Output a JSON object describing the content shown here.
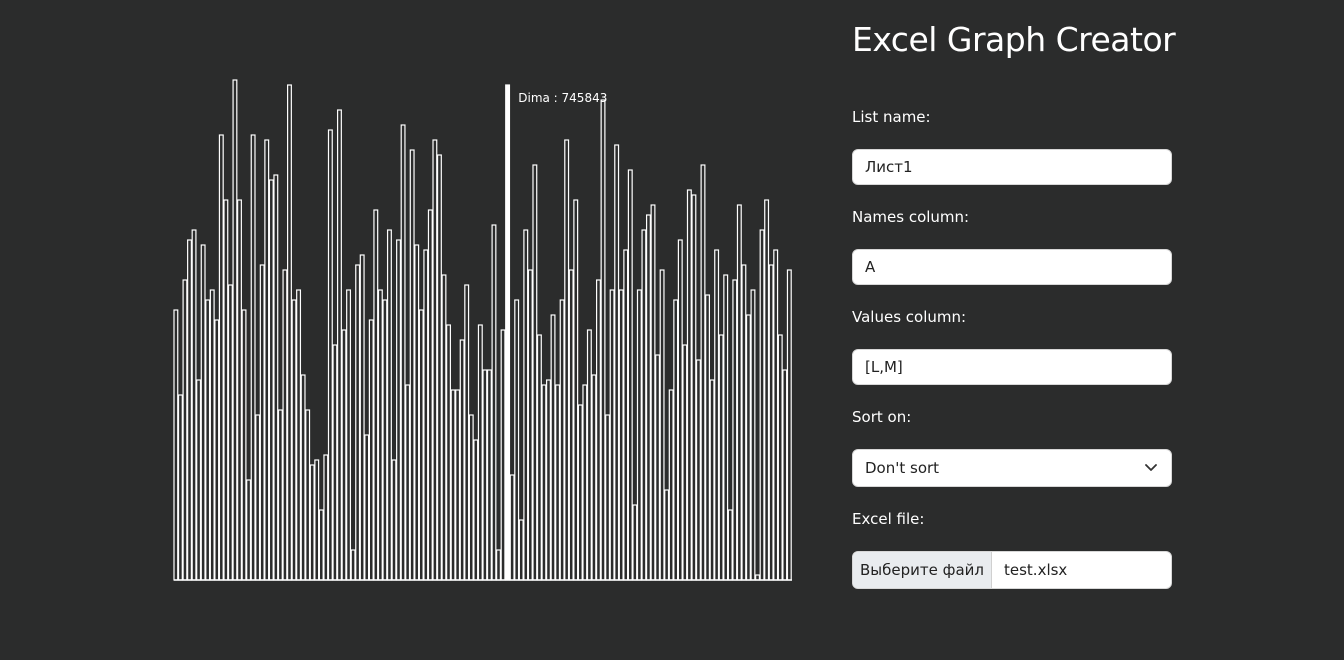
{
  "app": {
    "title": "Excel Graph Creator"
  },
  "form": {
    "list_name_label": "List name:",
    "list_name_value": "Лист1",
    "names_column_label": "Names column:",
    "names_column_value": "A",
    "values_column_label": "Values column:",
    "values_column_value": "[L,M]",
    "sort_label": "Sort on:",
    "sort_selected": "Don't sort",
    "file_label": "Excel file:",
    "file_button": "Выберите файл",
    "file_name": "test.xlsx"
  },
  "chart_data": {
    "type": "bar",
    "tooltip": {
      "text": "Dima : 745843",
      "highlight_index": 73
    },
    "values": [
      0.54,
      0.37,
      0.6,
      0.68,
      0.7,
      0.4,
      0.67,
      0.56,
      0.58,
      0.52,
      0.89,
      0.76,
      0.59,
      1.0,
      0.76,
      0.54,
      0.2,
      0.89,
      0.33,
      0.63,
      0.88,
      0.8,
      0.81,
      0.34,
      0.62,
      0.99,
      0.56,
      0.58,
      0.41,
      0.34,
      0.23,
      0.24,
      0.14,
      0.25,
      0.9,
      0.47,
      0.94,
      0.5,
      0.58,
      0.06,
      0.63,
      0.65,
      0.29,
      0.52,
      0.74,
      0.58,
      0.56,
      0.7,
      0.24,
      0.68,
      0.91,
      0.39,
      0.86,
      0.67,
      0.54,
      0.66,
      0.74,
      0.88,
      0.85,
      0.61,
      0.51,
      0.38,
      0.38,
      0.48,
      0.59,
      0.33,
      0.28,
      0.51,
      0.42,
      0.42,
      0.71,
      0.06,
      0.5,
      0.99,
      0.21,
      0.56,
      0.12,
      0.7,
      0.62,
      0.83,
      0.49,
      0.39,
      0.4,
      0.53,
      0.39,
      0.56,
      0.88,
      0.62,
      0.76,
      0.35,
      0.39,
      0.5,
      0.41,
      0.6,
      0.96,
      0.33,
      0.58,
      0.87,
      0.58,
      0.66,
      0.82,
      0.15,
      0.58,
      0.7,
      0.73,
      0.75,
      0.45,
      0.62,
      0.18,
      0.38,
      0.56,
      0.68,
      0.47,
      0.78,
      0.77,
      0.44,
      0.83,
      0.57,
      0.4,
      0.66,
      0.49,
      0.61,
      0.14,
      0.6,
      0.75,
      0.63,
      0.53,
      0.58,
      0.01,
      0.7,
      0.76,
      0.63,
      0.66,
      0.49,
      0.42,
      0.62
    ]
  }
}
